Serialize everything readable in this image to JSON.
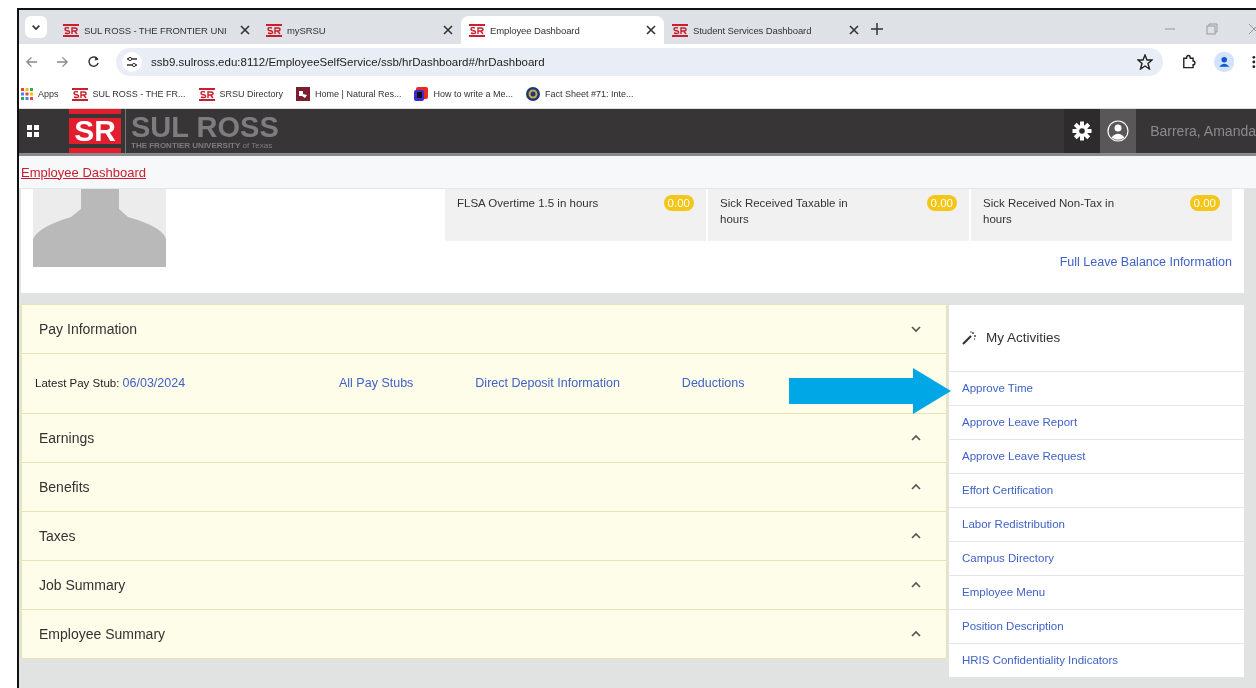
{
  "browser": {
    "tabs": [
      {
        "title": "SUL ROSS - THE FRONTIER UNI",
        "selected": false
      },
      {
        "title": "mySRSU",
        "selected": false
      },
      {
        "title": "Employee Dashboard",
        "selected": true
      },
      {
        "title": "Student Services Dashboard",
        "selected": false
      }
    ],
    "address": "ssb9.sulross.edu:8112/EmployeeSelfService/ssb/hrDashboard#/hrDashboard",
    "bookmarks": [
      {
        "label": "Apps",
        "kind": "apps"
      },
      {
        "label": "SUL ROSS - THE FR...",
        "kind": "sr"
      },
      {
        "label": "SRSU Directory",
        "kind": "sr"
      },
      {
        "label": "Home | Natural Res...",
        "kind": "map"
      },
      {
        "label": "How to write a Me...",
        "kind": "doc"
      },
      {
        "label": "Fact Sheet #71: Inte...",
        "kind": "seal"
      }
    ]
  },
  "header": {
    "logo_initials": "SR",
    "logo_name": "SUL ROSS",
    "logo_tagline": "THE FRONTIER UNIVERSITY",
    "logo_tagline_suffix": "of Texas",
    "user_name": "Barrera, Amanda"
  },
  "breadcrumb": "Employee Dashboard",
  "leave_balances": [
    {
      "label": "FLSA Overtime 1.5 in hours",
      "value": "0.00"
    },
    {
      "label": "Sick Received Taxable in hours",
      "value": "0.00"
    },
    {
      "label": "Sick Received Non-Tax in hours",
      "value": "0.00"
    }
  ],
  "full_leave_link": "Full Leave Balance Information",
  "pay_information": {
    "title": "Pay Information",
    "expanded": true,
    "latest_label": "Latest Pay Stub:",
    "latest_date": "06/03/2024",
    "links": [
      "All Pay Stubs",
      "Direct Deposit Information",
      "Deductions"
    ]
  },
  "panels": [
    {
      "title": "Earnings",
      "expanded": false
    },
    {
      "title": "Benefits",
      "expanded": false
    },
    {
      "title": "Taxes",
      "expanded": false
    },
    {
      "title": "Job Summary",
      "expanded": false
    },
    {
      "title": "Employee Summary",
      "expanded": false
    }
  ],
  "activities": {
    "title": "My Activities",
    "items": [
      "Approve Time",
      "Approve Leave Report",
      "Approve Leave Request",
      "Effort Certification",
      "Labor Redistribution",
      "Campus Directory",
      "Employee Menu",
      "Position Description",
      "HRIS Confidentiality Indicators"
    ]
  }
}
